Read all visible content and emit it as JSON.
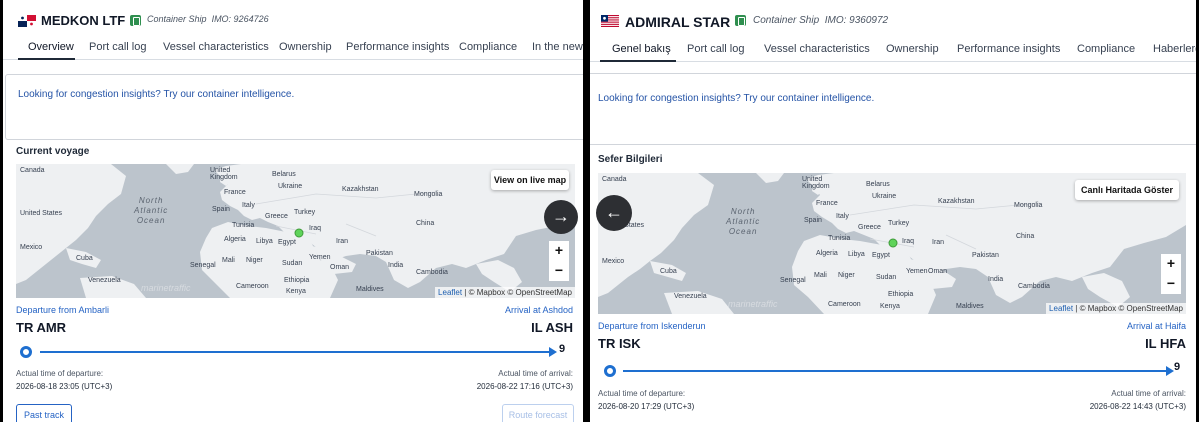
{
  "left_panel": {
    "vessel_name": "MEDKON LTF",
    "vessel_type": "Container Ship",
    "imo": "IMO: 9264726",
    "tabs": [
      "Overview",
      "Port call log",
      "Vessel characteristics",
      "Ownership",
      "Performance insights",
      "Compliance",
      "In the news"
    ],
    "active_tab": "Overview",
    "promo_text": "Looking for congestion insights? Try our container intelligence.",
    "section_title": "Current voyage",
    "live_map_button": "View on live map",
    "zoom_in": "+",
    "zoom_out": "−",
    "attribution_leaflet": "Leaflet",
    "attribution_rest": " | © Mapbox © OpenStreetMap",
    "watermark": "marinetraffic",
    "map_labels": {
      "canada": "Canada",
      "united_kingdom": "United Kingdom",
      "belarus": "Belarus",
      "france": "France",
      "ukraine": "Ukraine",
      "kazakhstan": "Kazakhstan",
      "mongolia": "Mongolia",
      "united_states": "United States",
      "spain": "Spain",
      "italy": "Italy",
      "greece": "Greece",
      "turkey": "Turkey",
      "iraq": "Iraq",
      "iran": "Iran",
      "china": "China",
      "tunisia": "Tunisia",
      "algeria": "Algeria",
      "libya": "Libya",
      "egypt": "Egypt",
      "mexico": "Mexico",
      "cuba": "Cuba",
      "senegal": "Senegal",
      "mali": "Mali",
      "niger": "Niger",
      "sudan": "Sudan",
      "yemen": "Yemen",
      "pakistan": "Pakistan",
      "india": "India",
      "cambodia": "Cambodia",
      "venezuela": "Venezuela",
      "cameroon": "Cameroon",
      "ethiopia": "Ethiopia",
      "maldives": "Maldives",
      "kenya": "Kenya",
      "oman": "Oman"
    },
    "ocean_label": "North\nAtlantic\nOcean",
    "departure_label": "Departure from Ambarli",
    "arrival_label": "Arrival at Ashdod",
    "departure_code": "TR AMR",
    "arrival_code": "IL ASH",
    "end_marker": "9",
    "departure_time_label": "Actual time of departure:",
    "departure_time": "2026-08-18 23:05 (UTC+3)",
    "arrival_time_label": "Actual time of arrival:",
    "arrival_time": "2026-08-22 17:16 (UTC+3)",
    "past_track_button": "Past track",
    "route_forecast_button": "Route forecast",
    "next_button_icon": "arrow-right-icon",
    "next_arrow": "→"
  },
  "right_panel": {
    "vessel_name": "ADMIRAL STAR",
    "vessel_type": "Container Ship",
    "imo": "IMO: 9360972",
    "tabs": [
      "Genel bakış",
      "Port call log",
      "Vessel characteristics",
      "Ownership",
      "Performance insights",
      "Compliance",
      "Haberlerde"
    ],
    "active_tab": "Genel bakış",
    "promo_text": "Looking for congestion insights? Try our container intelligence.",
    "section_title": "Sefer Bilgileri",
    "live_map_button": "Canlı Haritada Göster",
    "zoom_in": "+",
    "zoom_out": "−",
    "attribution_leaflet": "Leaflet",
    "attribution_rest": " | © Mapbox © OpenStreetMap",
    "watermark": "marinetraffic",
    "ocean_label": "North\nAtlantic\nOcean",
    "departure_label": "Departure from Iskenderun",
    "arrival_label": "Arrival at Haifa",
    "departure_code": "TR ISK",
    "arrival_code": "IL HFA",
    "end_marker": "9",
    "departure_time_label": "Actual time of departure:",
    "departure_time": "2026-08-20 17:29 (UTC+3)",
    "arrival_time_label": "Actual time of arrival:",
    "arrival_time": "2026-08-22 14:43 (UTC+3)",
    "prev_button_icon": "arrow-left-icon",
    "prev_arrow": "←"
  },
  "colors": {
    "accent": "#1e6fd0",
    "link": "#2563c4",
    "map_water": "#bcc4cc",
    "map_land": "#eef0f2",
    "ship_dot": "#5fd35a"
  }
}
